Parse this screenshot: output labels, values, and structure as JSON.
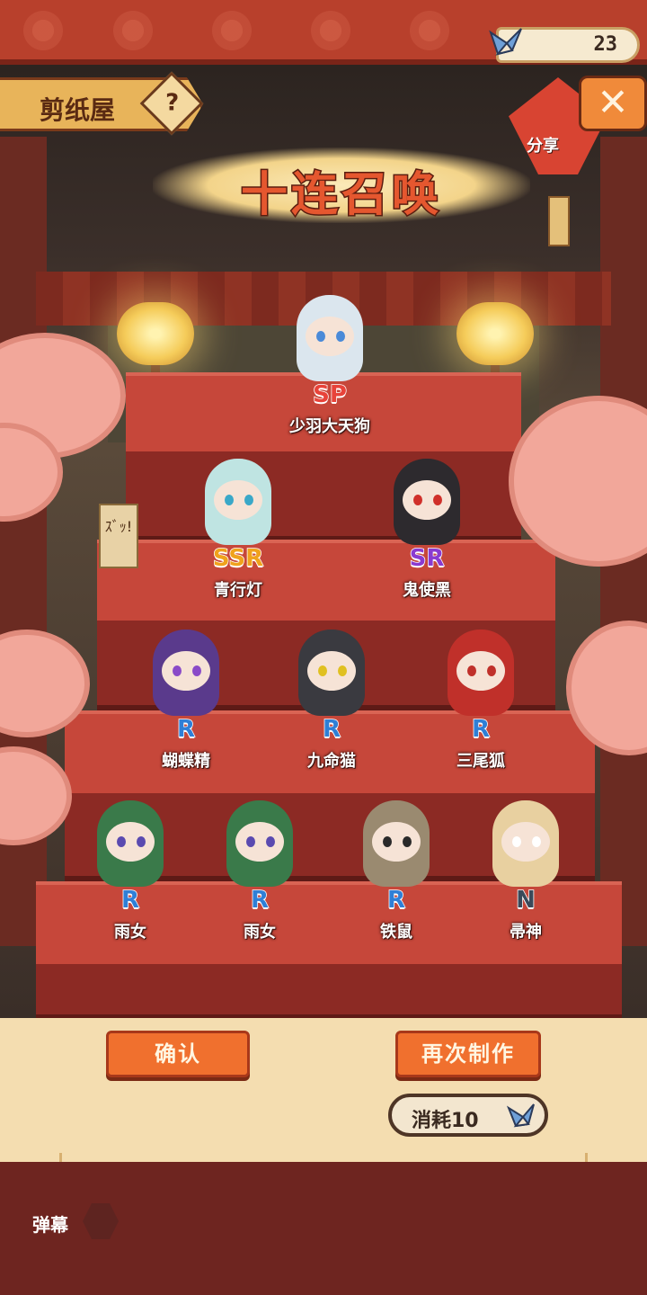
{
  "header": {
    "location_label": "剪纸屋",
    "help_symbol": "?",
    "title": "十连召唤",
    "currency_count": "23",
    "share_label": "分享",
    "close_symbol": "✕"
  },
  "summons": [
    {
      "name": "少羽大天狗",
      "rarity": "SP",
      "rarity_color": "#e8433a",
      "body_color": "#dbe6ee",
      "eye_color": "#4a8ad8"
    },
    {
      "name": "青行灯",
      "rarity": "SSR",
      "rarity_color": "#f0a21c",
      "body_color": "#bfe4e2",
      "eye_color": "#3aa8c8"
    },
    {
      "name": "鬼使黑",
      "rarity": "SR",
      "rarity_color": "#8a3ad0",
      "body_color": "#2d2a2e",
      "eye_color": "#d0302a"
    },
    {
      "name": "蝴蝶精",
      "rarity": "R",
      "rarity_color": "#2f7fd6",
      "body_color": "#5a3a8c",
      "eye_color": "#8a4ac8"
    },
    {
      "name": "九命猫",
      "rarity": "R",
      "rarity_color": "#2f7fd6",
      "body_color": "#3a3a40",
      "eye_color": "#e0c020"
    },
    {
      "name": "三尾狐",
      "rarity": "R",
      "rarity_color": "#2f7fd6",
      "body_color": "#c0302a",
      "eye_color": "#c0302a"
    },
    {
      "name": "雨女",
      "rarity": "R",
      "rarity_color": "#2f7fd6",
      "body_color": "#3a7a4a",
      "eye_color": "#5a4ab0"
    },
    {
      "name": "雨女",
      "rarity": "R",
      "rarity_color": "#2f7fd6",
      "body_color": "#3a7a4a",
      "eye_color": "#5a4ab0"
    },
    {
      "name": "铁鼠",
      "rarity": "R",
      "rarity_color": "#2f7fd6",
      "body_color": "#9a8a70",
      "eye_color": "#2a2a2a"
    },
    {
      "name": "帚神",
      "rarity": "N",
      "rarity_color": "#3a4a5a",
      "body_color": "#e8d0a0",
      "eye_color": "#ffffff"
    }
  ],
  "actions": {
    "confirm_label": "确认",
    "repeat_label": "再次制作",
    "cost_label": "消耗10"
  },
  "footer": {
    "danmaku_label": "弹幕"
  },
  "sign_text": "ｽﾞｯ!"
}
